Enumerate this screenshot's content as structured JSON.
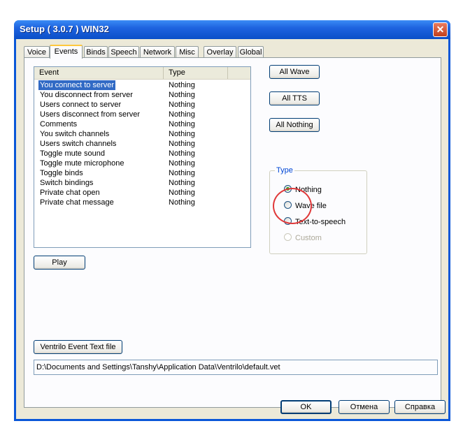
{
  "window": {
    "title": "Setup ( 3.0.7 ) WIN32",
    "close_glyph": "✕"
  },
  "tabs": [
    {
      "label": "Voice"
    },
    {
      "label": "Events"
    },
    {
      "label": "Binds"
    },
    {
      "label": "Speech"
    },
    {
      "label": "Network"
    },
    {
      "label": "Misc"
    },
    {
      "label": "Overlay"
    },
    {
      "label": "Global"
    }
  ],
  "active_tab": "Events",
  "events_list": {
    "columns": [
      "Event",
      "Type"
    ],
    "rows": [
      {
        "event": "You connect to server",
        "type": "Nothing"
      },
      {
        "event": "You disconnect from server",
        "type": "Nothing"
      },
      {
        "event": "Users connect to server",
        "type": "Nothing"
      },
      {
        "event": "Users disconnect from server",
        "type": "Nothing"
      },
      {
        "event": "Comments",
        "type": "Nothing"
      },
      {
        "event": "You switch channels",
        "type": "Nothing"
      },
      {
        "event": "Users switch channels",
        "type": "Nothing"
      },
      {
        "event": "Toggle mute sound",
        "type": "Nothing"
      },
      {
        "event": "Toggle mute microphone",
        "type": "Nothing"
      },
      {
        "event": "Toggle binds",
        "type": "Nothing"
      },
      {
        "event": "Switch bindings",
        "type": "Nothing"
      },
      {
        "event": "Private chat open",
        "type": "Nothing"
      },
      {
        "event": "Private chat message",
        "type": "Nothing"
      }
    ],
    "selected_index": 0
  },
  "buttons": {
    "all_wave": "All Wave",
    "all_tts": "All TTS",
    "all_nothing": "All Nothing",
    "play": "Play",
    "event_text_file": "Ventrilo Event Text file"
  },
  "type_group": {
    "label": "Type",
    "options": [
      {
        "label": "Nothing",
        "selected": true,
        "enabled": true
      },
      {
        "label": "Wave file",
        "selected": false,
        "enabled": true
      },
      {
        "label": "Text-to-speech",
        "selected": false,
        "enabled": true
      },
      {
        "label": "Custom",
        "selected": false,
        "enabled": false
      }
    ]
  },
  "event_file_path": "D:\\Documents and Settings\\Tanshy\\Application Data\\Ventrilo\\default.vet",
  "dialog_buttons": {
    "ok": "OK",
    "cancel": "Отмена",
    "help": "Справка"
  },
  "colors": {
    "selection": "#316ac5",
    "highlight_circle": "#e0393a",
    "title_bar": "#0a57d8"
  }
}
